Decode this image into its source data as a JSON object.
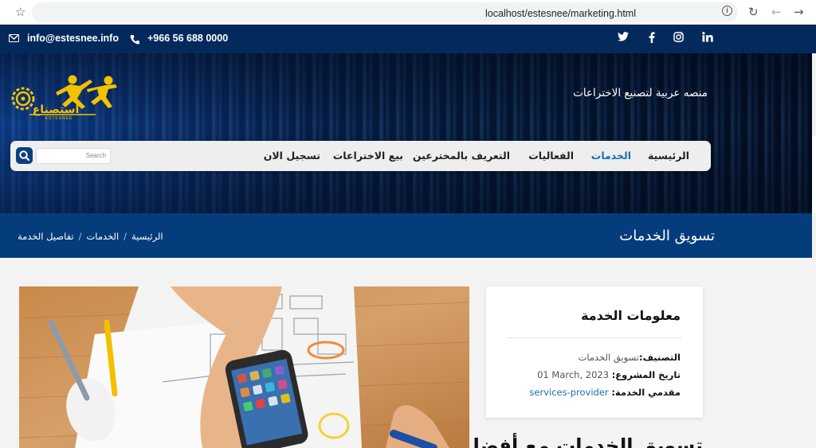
{
  "browser": {
    "url": "localhost/estesnee/marketing.html",
    "icons": [
      "star-icon",
      "tab-share-icon",
      "info-icon",
      "reload-icon",
      "back-icon",
      "forward-icon"
    ]
  },
  "topbar": {
    "email": "info@estesnee.info",
    "phone": "+966 56 688 0000",
    "socials": [
      "twitter",
      "facebook",
      "instagram",
      "linkedin"
    ]
  },
  "hero": {
    "tagline": "منصه عربية لتصنيع الاختراعات",
    "logo_text": "استصناع",
    "logo_subtext": "ESTESNEE"
  },
  "nav": {
    "items": [
      {
        "label": "الرئيسية",
        "active": false
      },
      {
        "label": "الخدمات",
        "active": true
      },
      {
        "label": "الفعاليات",
        "active": false
      },
      {
        "label": "التعريف بالمخترعين",
        "active": false
      },
      {
        "label": "بيع الاختراعات",
        "active": false
      },
      {
        "label": "تسجيل الان",
        "active": false
      }
    ],
    "search_placeholder": "Search"
  },
  "title_band": {
    "title": "تسويق الخدمات",
    "breadcrumb": [
      "الرئيسية",
      "الخدمات",
      "تفاصيل الخدمة"
    ]
  },
  "card": {
    "title": "معلومات الخدمة",
    "category_label": "التصنيف:",
    "category_value": "تسويق الخدمات",
    "date_label": "تاريخ المشروع:",
    "date_value": "01 March, 2023",
    "provider_label": "مقدمي الخدمة:",
    "provider_value": "services-provider"
  },
  "section_heading": "تسويق الخدمات مع أفضل",
  "colors": {
    "topbar": "#042a5c",
    "title_band": "#053c7c",
    "accent": "#1a6db4",
    "logo_gold": "#f2c200"
  }
}
